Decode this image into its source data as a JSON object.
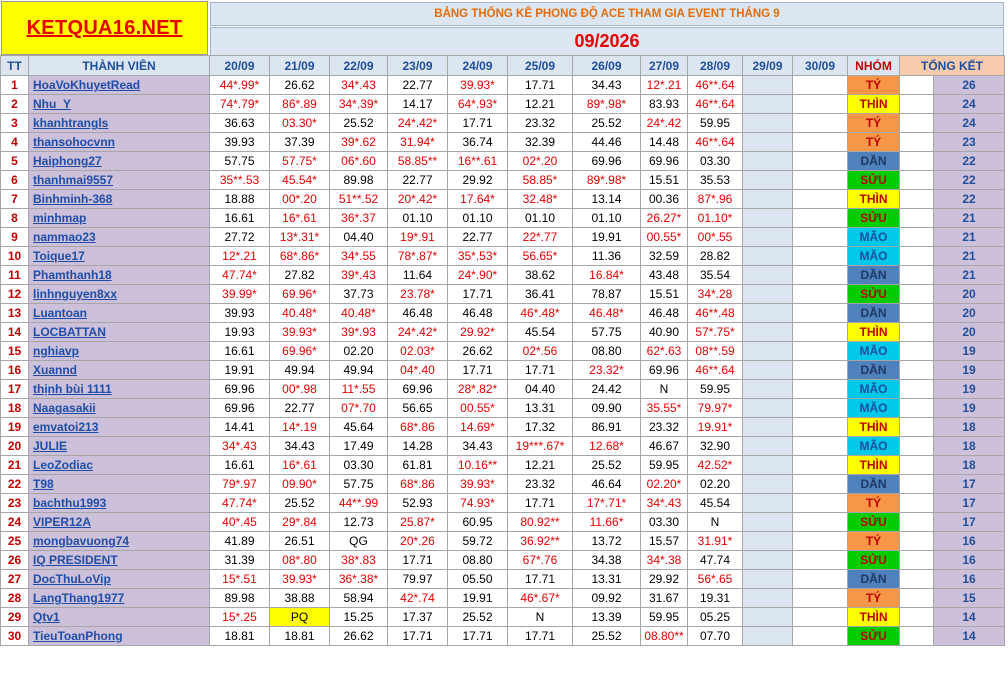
{
  "brand": "KETQUA16.NET",
  "title": "BẢNG THỐNG KÊ PHONG ĐỘ ACE THAM GIA EVENT THÁNG 9",
  "month": "09/2026",
  "headers": {
    "tt": "TT",
    "member": "THÀNH VIÊN",
    "dates": [
      "20/09",
      "21/09",
      "22/09",
      "23/09",
      "24/09",
      "25/09",
      "26/09",
      "27/09",
      "28/09",
      "29/09",
      "30/09"
    ],
    "group": "NHÓM",
    "total": "TỔNG KẾT"
  },
  "rows": [
    {
      "tt": "1",
      "name": "HoaVoKhuyetRead",
      "cells": [
        "44*.99*",
        "26.62",
        "34*.43",
        "22.77",
        "39.93*",
        "17.71",
        "34.43",
        "12*.21",
        "46**.64"
      ],
      "group": "TÝ",
      "score": "26"
    },
    {
      "tt": "2",
      "name": "Nhu_Y",
      "cells": [
        "74*.79*",
        "86*.89",
        "34*.39*",
        "14.17",
        "64*.93*",
        "12.21",
        "89*.98*",
        "83.93",
        "46**.64"
      ],
      "group": "THÌN",
      "score": "24"
    },
    {
      "tt": "3",
      "name": "khanhtrangls",
      "cells": [
        "36.63",
        "03.30*",
        "25.52",
        "24*.42*",
        "17.71",
        "23.32",
        "25.52",
        "24*.42",
        "59.95"
      ],
      "group": "TÝ",
      "score": "24"
    },
    {
      "tt": "4",
      "name": "thansohocvnn",
      "cells": [
        "39.93",
        "37.39",
        "39*.62",
        "31.94*",
        "36.74",
        "32.39",
        "44.46",
        "14.48",
        "46**.64"
      ],
      "group": "TÝ",
      "score": "23"
    },
    {
      "tt": "5",
      "name": "Haiphong27",
      "cells": [
        "57.75",
        "57.75*",
        "06*.60",
        "58.85**",
        "16**.61",
        "02*.20",
        "69.96",
        "69.96",
        "03.30"
      ],
      "group": "DẦN",
      "score": "22"
    },
    {
      "tt": "6",
      "name": "thanhmai9557",
      "cells": [
        "35**.53",
        "45.54*",
        "89.98",
        "22.77",
        "29.92",
        "58.85*",
        "89*.98*",
        "15.51",
        "35.53"
      ],
      "group": "SỬU",
      "score": "22"
    },
    {
      "tt": "7",
      "name": "Binhminh-368",
      "cells": [
        "18.88",
        "00*.20",
        "51**.52",
        "20*.42*",
        "17.64*",
        "32.48*",
        "13.14",
        "00.36",
        "87*.96"
      ],
      "group": "THÌN",
      "score": "22"
    },
    {
      "tt": "8",
      "name": "minhmap",
      "cells": [
        "16.61",
        "16*.61",
        "36*.37",
        "01.10",
        "01.10",
        "01.10",
        "01.10",
        "26.27*",
        "01.10*"
      ],
      "group": "SỬU",
      "score": "21"
    },
    {
      "tt": "9",
      "name": "nammao23",
      "cells": [
        "27.72",
        "13*.31*",
        "04.40",
        "19*.91",
        "22.77",
        "22*.77",
        "19.91",
        "00.55*",
        "00*.55"
      ],
      "group": "MÃO",
      "score": "21"
    },
    {
      "tt": "10",
      "name": "Toique17",
      "cells": [
        "12*.21",
        "68*.86*",
        "34*.55",
        "78*.87*",
        "35*.53*",
        "56.65*",
        "11.36",
        "32.59",
        "28.82"
      ],
      "group": "MÃO",
      "score": "21"
    },
    {
      "tt": "11",
      "name": "Phamthanh18",
      "cells": [
        "47.74*",
        "27.82",
        "39*.43",
        "11.64",
        "24*.90*",
        "38.62",
        "16.84*",
        "43.48",
        "35.54"
      ],
      "group": "DẦN",
      "score": "21"
    },
    {
      "tt": "12",
      "name": "linhnguyen8xx",
      "cells": [
        "39.99*",
        "69.96*",
        "37.73",
        "23.78*",
        "17.71",
        "36.41",
        "78.87",
        "15.51",
        "34*.28"
      ],
      "group": "SỬU",
      "score": "20"
    },
    {
      "tt": "13",
      "name": "Luantoan",
      "cells": [
        "39.93",
        "40.48*",
        "40.48*",
        "46.48",
        "46.48",
        "46*.48*",
        "46.48*",
        "46.48",
        "46**.48"
      ],
      "group": "DẦN",
      "score": "20"
    },
    {
      "tt": "14",
      "name": "LOCBATTAN",
      "cells": [
        "19.93",
        "39.93*",
        "39*.93",
        "24*.42*",
        "29.92*",
        "45.54",
        "57.75",
        "40.90",
        "57*.75*"
      ],
      "group": "THÌN",
      "score": "20"
    },
    {
      "tt": "15",
      "name": "nghiavp",
      "cells": [
        "16.61",
        "69.96*",
        "02.20",
        "02.03*",
        "26.62",
        "02*.56",
        "08.80",
        "62*.63",
        "08**.59"
      ],
      "group": "MÃO",
      "score": "19"
    },
    {
      "tt": "16",
      "name": "Xuannd",
      "cells": [
        "19.91",
        "49.94",
        "49.94",
        "04*.40",
        "17.71",
        "17.71",
        "23.32*",
        "69.96",
        "46**.64"
      ],
      "group": "DẦN",
      "score": "19"
    },
    {
      "tt": "17",
      "name": "thịnh bùi 1111",
      "cells": [
        "69.96",
        "00*.98",
        "11*.55",
        "69.96",
        "28*.82*",
        "04.40",
        "24.42",
        "N",
        "59.95"
      ],
      "group": "MÃO",
      "score": "19"
    },
    {
      "tt": "18",
      "name": "Naagasakii",
      "cells": [
        "69.96",
        "22.77",
        "07*.70",
        "56.65",
        "00.55*",
        "13.31",
        "09.90",
        "35.55*",
        "79.97*"
      ],
      "group": "MÃO",
      "score": "19"
    },
    {
      "tt": "19",
      "name": "emvatoi213",
      "cells": [
        "14.41",
        "14*.19",
        "45.64",
        "68*.86",
        "14.69*",
        "17.32",
        "86.91",
        "23.32",
        "19.91*"
      ],
      "group": "THÌN",
      "score": "18"
    },
    {
      "tt": "20",
      "name": "JULIE",
      "cells": [
        "34*.43",
        "34.43",
        "17.49",
        "14.28",
        "34.43",
        "19***.67*",
        "12.68*",
        "46.67",
        "32.90"
      ],
      "group": "MÃO",
      "score": "18"
    },
    {
      "tt": "21",
      "name": "LeoZodiac",
      "cells": [
        "16.61",
        "16*.61",
        "03.30",
        "61.81",
        "10.16**",
        "12.21",
        "25.52",
        "59.95",
        "42.52*"
      ],
      "group": "THÌN",
      "score": "18"
    },
    {
      "tt": "22",
      "name": "T98",
      "cells": [
        "79*.97",
        "09.90*",
        "57.75",
        "68*.86",
        "39.93*",
        "23.32",
        "46.64",
        "02.20*",
        "02.20"
      ],
      "group": "DẦN",
      "score": "17"
    },
    {
      "tt": "23",
      "name": "bachthu1993",
      "cells": [
        "47.74*",
        "25.52",
        "44**.99",
        "52.93",
        "74.93*",
        "17.71",
        "17*.71*",
        "34*.43",
        "45.54"
      ],
      "group": "TÝ",
      "score": "17"
    },
    {
      "tt": "24",
      "name": "VIPER12A",
      "cells": [
        "40*.45",
        "29*.84",
        "12.73",
        "25.87*",
        "60.95",
        "80.92**",
        "11.66*",
        "03.30",
        "N"
      ],
      "group": "SỬU",
      "score": "17"
    },
    {
      "tt": "25",
      "name": "mongbavuong74",
      "cells": [
        "41.89",
        "26.51",
        "QG",
        "20*.26",
        "59.72",
        "36.92**",
        "13.72",
        "15.57",
        "31.91*"
      ],
      "group": "TÝ",
      "score": "16"
    },
    {
      "tt": "26",
      "name": "IQ PRESIDENT",
      "cells": [
        "31.39",
        "08*.80",
        "38*.83",
        "17.71",
        "08.80",
        "67*.76",
        "34.38",
        "34*.38",
        "47.74"
      ],
      "group": "SỬU",
      "score": "16"
    },
    {
      "tt": "27",
      "name": "DocThuLoVip",
      "cells": [
        "15*.51",
        "39.93*",
        "36*.38*",
        "79.97",
        "05.50",
        "17.71",
        "13.31",
        "29.92",
        "56*.65"
      ],
      "group": "DẦN",
      "score": "16"
    },
    {
      "tt": "28",
      "name": "LangThang1977",
      "cells": [
        "89.98",
        "38.88",
        "58.94",
        "42*.74",
        "19.91",
        "46*.67*",
        "09.92",
        "31.67",
        "19.31"
      ],
      "group": "TÝ",
      "score": "15"
    },
    {
      "tt": "29",
      "name": "Qtv1",
      "cells": [
        "15*.25",
        "PQ",
        "15.25",
        "17.37",
        "25.52",
        "N",
        "13.39",
        "59.95",
        "05.25"
      ],
      "group": "THÌN",
      "score": "14"
    },
    {
      "tt": "30",
      "name": "TieuToanPhong",
      "cells": [
        "18.81",
        "18.81",
        "26.62",
        "17.71",
        "17.71",
        "17.71",
        "25.52",
        "08.80**",
        "07.70"
      ],
      "group": "SỬU",
      "score": "14"
    }
  ],
  "colors": {
    "header_bg": "#dce6f1",
    "name_bg": "#ccc0da",
    "red_text": "#e60000",
    "group_TY": "#f79646",
    "group_THIN": "#ffff00",
    "group_DAN": "#4f81bd",
    "group_SUU": "#00cc00",
    "group_MAO": "#00c8e8"
  }
}
